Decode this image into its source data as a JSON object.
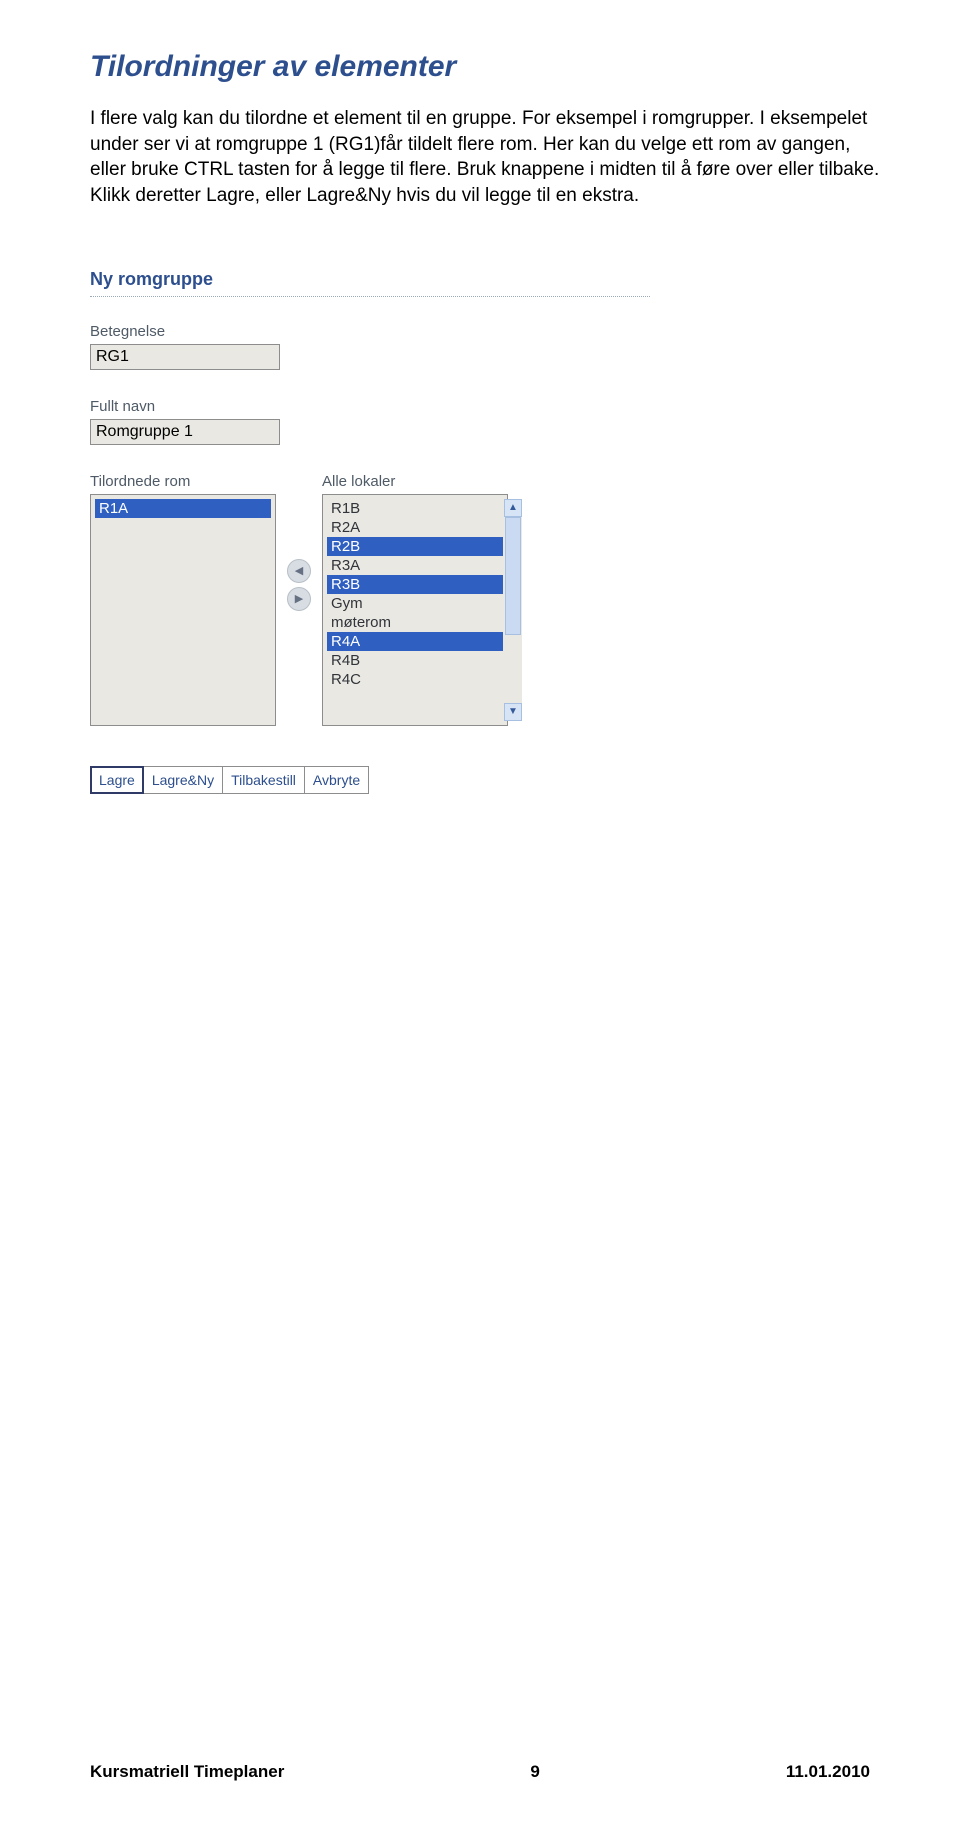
{
  "heading": "Tilordninger av elementer",
  "paragraph": "I flere valg kan du tilordne et element til en gruppe. For eksempel i romgrupper. I eksempelet under ser vi at romgruppe 1 (RG1)får tildelt flere rom. Her kan du velge ett rom av gangen, eller bruke CTRL tasten for å legge til flere. Bruk knappene i midten til å føre over eller tilbake. Klikk deretter Lagre, eller Lagre&Ny hvis du vil legge til en ekstra.",
  "dialog": {
    "title": "Ny romgruppe",
    "fields": {
      "betegnelse": {
        "label": "Betegnelse",
        "value": "RG1"
      },
      "fullt_navn": {
        "label": "Fullt navn",
        "value": "Romgruppe 1"
      }
    },
    "assigned": {
      "label": "Tilordnede rom",
      "items": [
        {
          "text": "R1A",
          "selected": true
        }
      ]
    },
    "all": {
      "label": "Alle lokaler",
      "items": [
        {
          "text": "R1B",
          "selected": false
        },
        {
          "text": "R2A",
          "selected": false
        },
        {
          "text": "R2B",
          "selected": true
        },
        {
          "text": "R3A",
          "selected": false
        },
        {
          "text": "R3B",
          "selected": true
        },
        {
          "text": "Gym",
          "selected": false
        },
        {
          "text": "møterom",
          "selected": false
        },
        {
          "text": "R4A",
          "selected": true
        },
        {
          "text": "R4B",
          "selected": false
        },
        {
          "text": "R4C",
          "selected": false
        }
      ]
    },
    "buttons": {
      "lagre": "Lagre",
      "lagre_ny": "Lagre&Ny",
      "tilbakestill": "Tilbakestill",
      "avbryte": "Avbryte"
    }
  },
  "footer": {
    "left": "Kursmatriell Timeplaner",
    "center": "9",
    "right": "11.01.2010"
  },
  "glyphs": {
    "left_tri": "◀",
    "right_tri": "▶",
    "up_tri": "▲",
    "down_tri": "▼"
  }
}
